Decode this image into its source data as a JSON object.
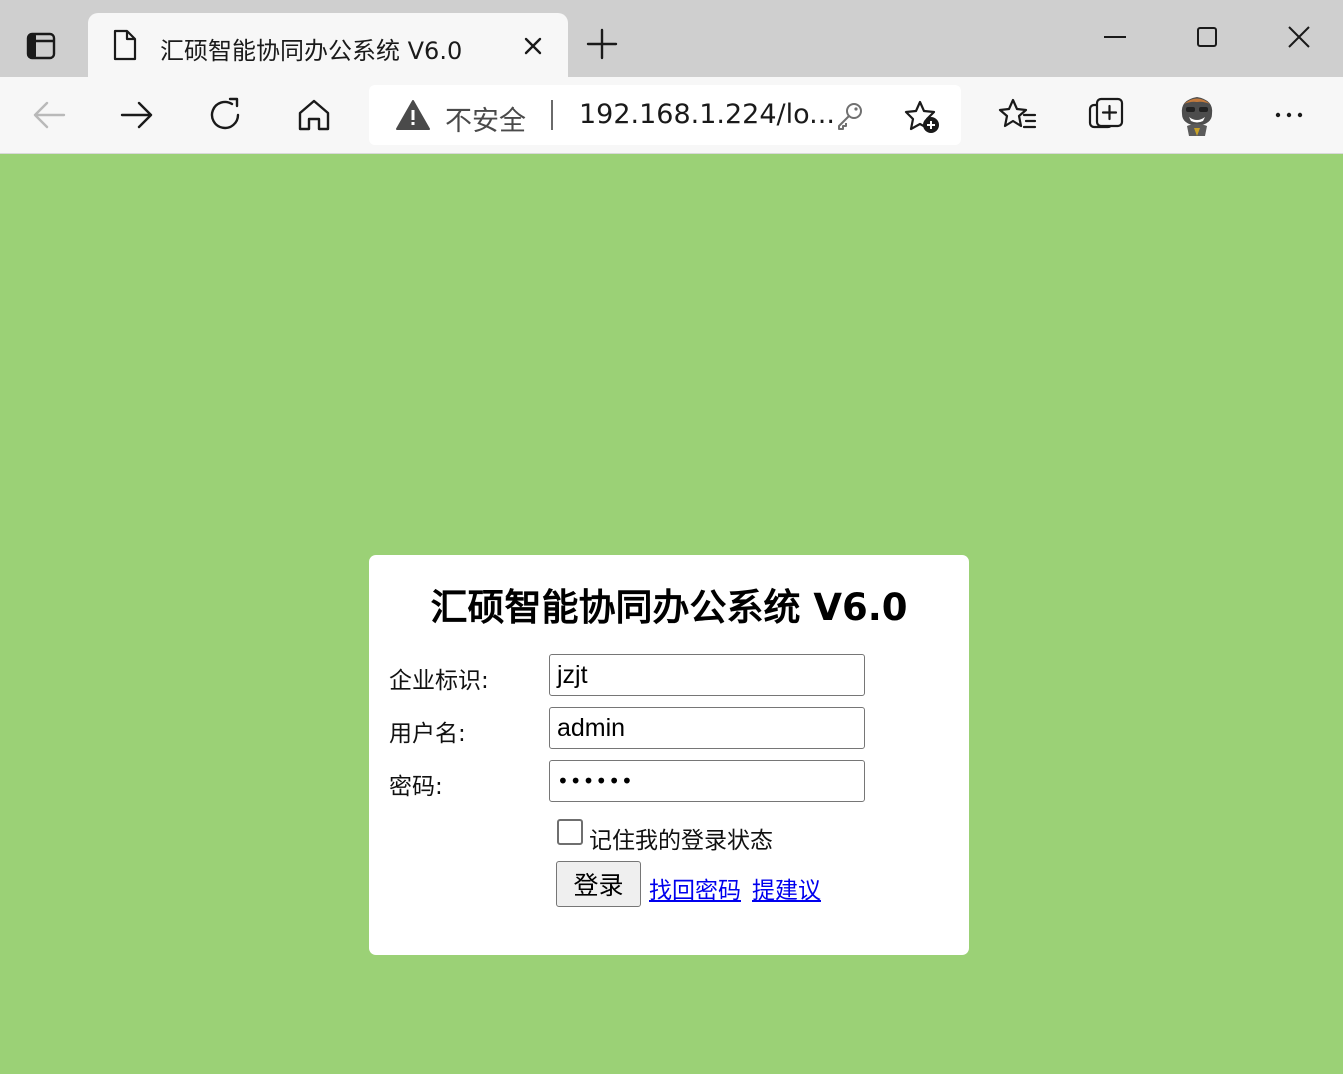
{
  "browser": {
    "tab": {
      "title": "汇硕智能协同办公系统 V6.0"
    },
    "address_bar": {
      "security_label": "不安全",
      "url": "192.168.1.224/lo..."
    }
  },
  "page": {
    "background_color": "#9bd176",
    "title": "汇硕智能协同办公系统 V6.0",
    "form": {
      "company_label": "企业标识:",
      "company_value": "jzjt",
      "username_label": "用户名:",
      "username_value": "admin",
      "password_label": "密码:",
      "password_value": "••••••",
      "remember_label": "记住我的登录状态",
      "remember_checked": false,
      "login_button": "登录",
      "forgot_password_link": "找回密码",
      "suggest_link": "提建议"
    }
  }
}
